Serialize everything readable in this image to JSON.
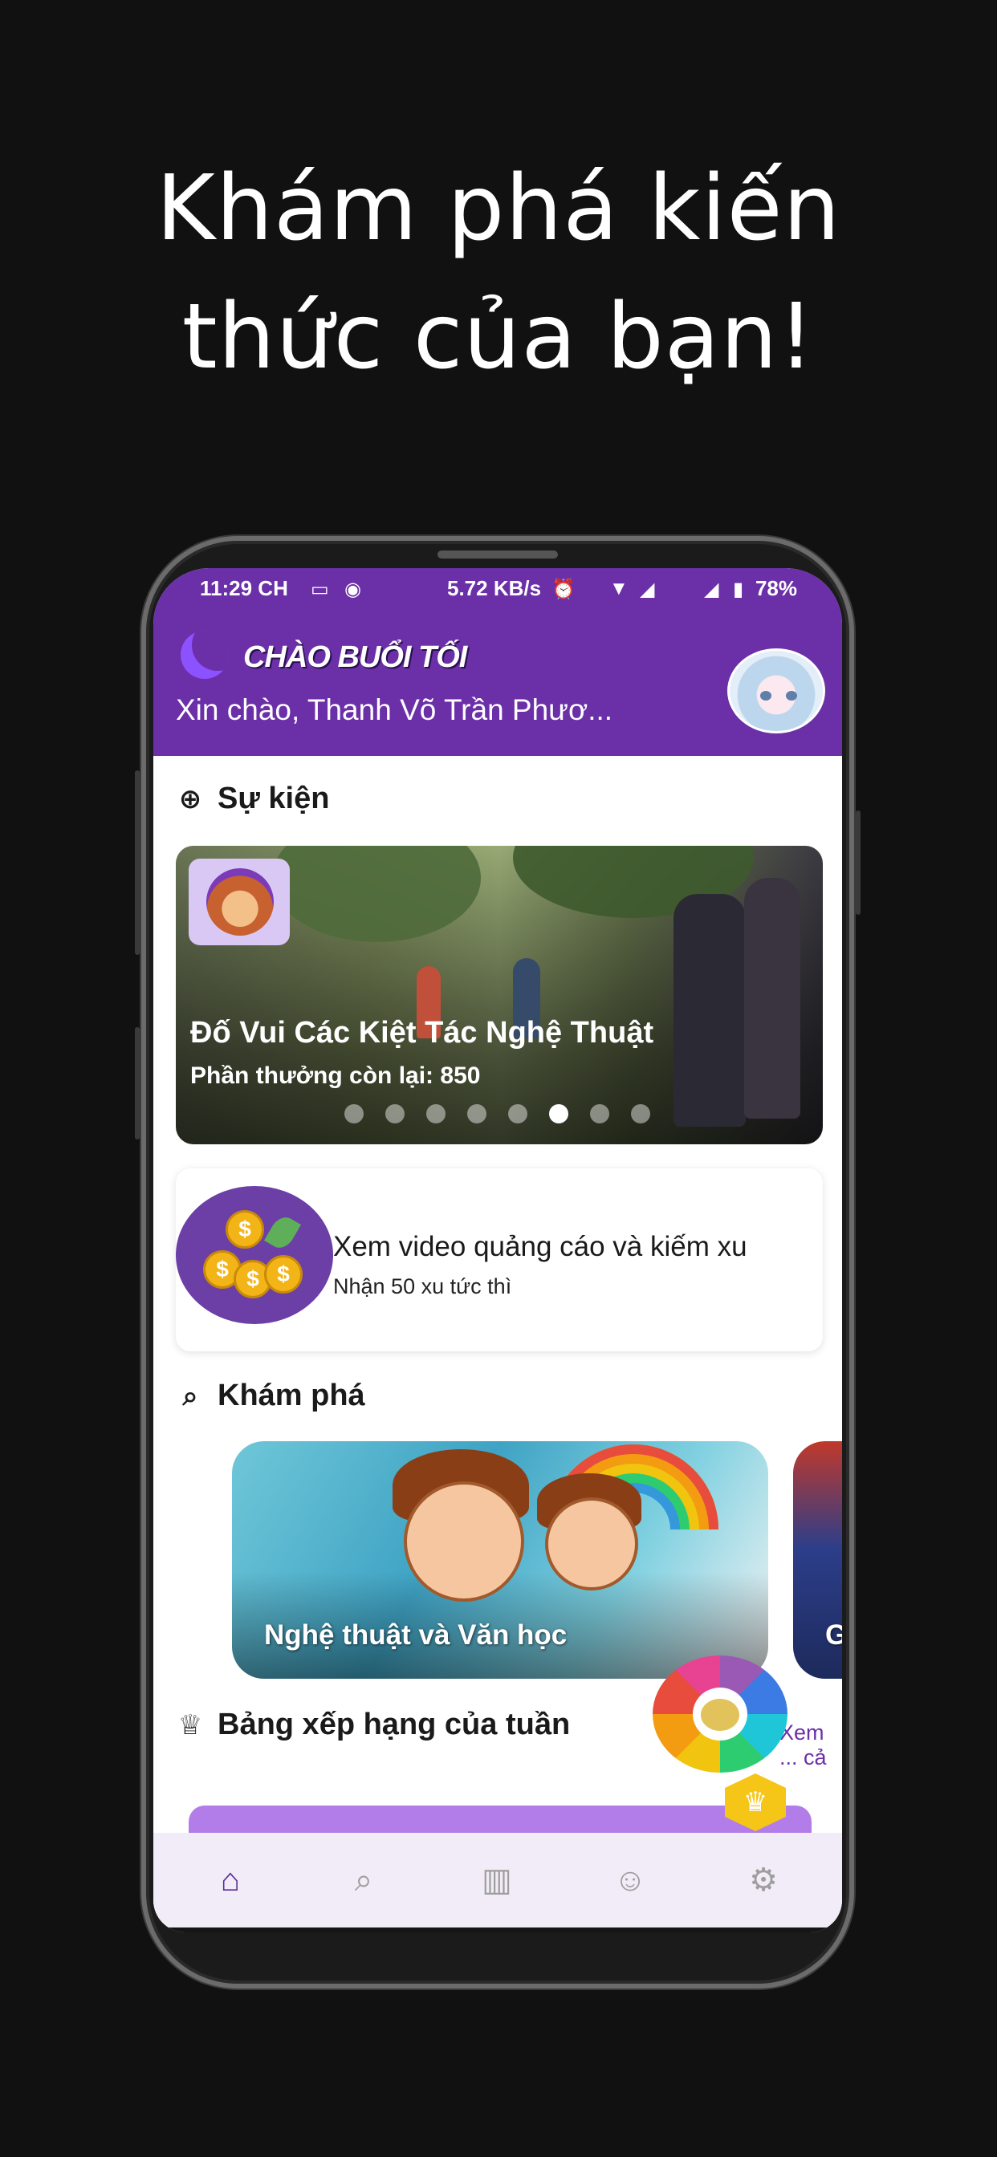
{
  "headline": {
    "line1": "Khám phá kiến",
    "line2": "thức của bạn!"
  },
  "status_bar": {
    "time": "11:29 CH",
    "speed": "5.72 KB/s",
    "battery": "78%"
  },
  "header": {
    "greeting": "CHÀO BUỔI TỐI",
    "user_greeting": "Xin chào, Thanh Võ Trần Phươ..."
  },
  "events": {
    "section_title": "Sự kiện",
    "card": {
      "title": "Đố Vui Các Kiệt Tác Nghệ Thuật",
      "subtitle": "Phần thưởng còn lại: 850"
    },
    "pagination": {
      "count": 8,
      "active_index": 5
    }
  },
  "reward": {
    "title": "Xem video quảng cáo và kiếm xu",
    "subtitle": "Nhận 50 xu tức thì"
  },
  "explore": {
    "section_title": "Khám phá",
    "cards": [
      {
        "label": "Nghệ thuật và Văn học"
      },
      {
        "label": "G"
      }
    ]
  },
  "leaderboard": {
    "section_title": "Bảng xếp hạng của tuần",
    "see_all": "Xem ... cả"
  },
  "bottom_nav": {
    "items": [
      {
        "name": "home",
        "icon": "home-icon",
        "active": true
      },
      {
        "name": "search",
        "icon": "search-icon",
        "active": false
      },
      {
        "name": "leaderboard",
        "icon": "bar-chart-icon",
        "active": false
      },
      {
        "name": "profile",
        "icon": "user-icon",
        "active": false
      },
      {
        "name": "settings",
        "icon": "gear-icon",
        "active": false
      }
    ]
  },
  "colors": {
    "primary": "#6b2fa8",
    "nav_background": "#f1ecf7",
    "accent_gold": "#f5c518"
  }
}
